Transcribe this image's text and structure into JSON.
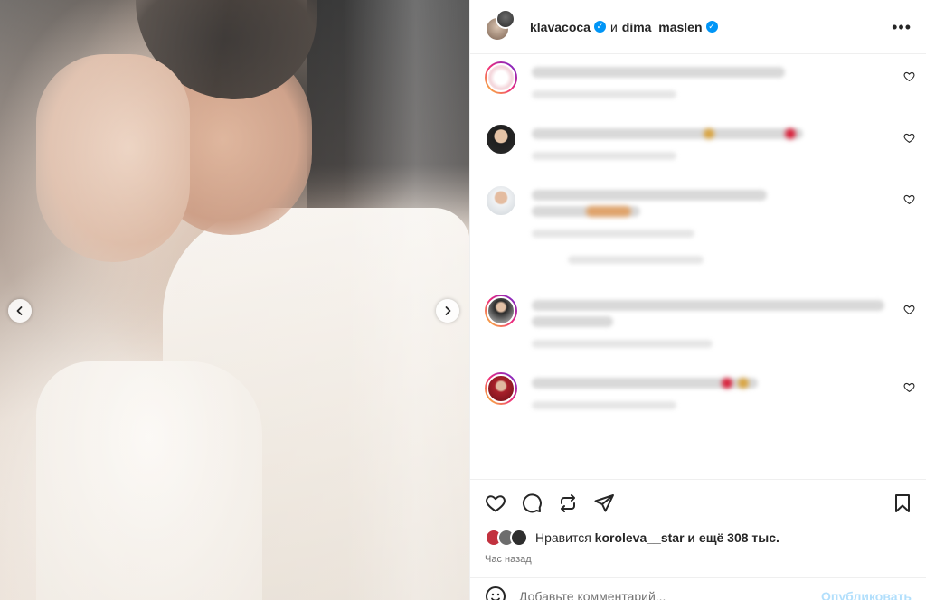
{
  "post": {
    "author": "klavacoca",
    "joiner": "и",
    "coauthor": "dima_maslen",
    "more_icon": "more-horizontal-icon",
    "more_label": "•••"
  },
  "carousel": {
    "prev_icon": "chevron-left-icon",
    "next_icon": "chevron-right-icon"
  },
  "comments": [
    {
      "avatar_color": "#ffffff",
      "ring": true,
      "accent": "#d8203a"
    },
    {
      "avatar_color": "#2b2b2b",
      "ring": false,
      "accent": "#e0bfa0"
    },
    {
      "avatar_color": "#cfd5da",
      "ring": false,
      "accent": "#d6a36e"
    },
    {
      "avatar_color": "#3a3a3a",
      "ring": true,
      "accent": "#9a9a9a"
    },
    {
      "avatar_color": "#b3202b",
      "ring": true,
      "accent": "#d43c3c"
    }
  ],
  "actions": {
    "like_icon": "heart-icon",
    "comment_icon": "comment-bubble-icon",
    "repost_icon": "repost-icon",
    "share_icon": "paper-plane-icon",
    "save_icon": "bookmark-icon"
  },
  "likes": {
    "prefix": "Нравится",
    "user": "koroleva__star",
    "suffix": "и ещё 308 тыс.",
    "avatar_colors": [
      "#c2323f",
      "#6d6d6d",
      "#2e2e2e"
    ]
  },
  "time_ago": "Час назад",
  "add_comment": {
    "placeholder": "Добавьте комментарий...",
    "publish_label": "Опубликовать",
    "emoji_icon": "emoji-smile-icon"
  },
  "colors": {
    "accent_blue": "#0095f6",
    "publish_disabled": "#b2dffc",
    "text_primary": "#262626",
    "text_secondary": "#737373"
  }
}
